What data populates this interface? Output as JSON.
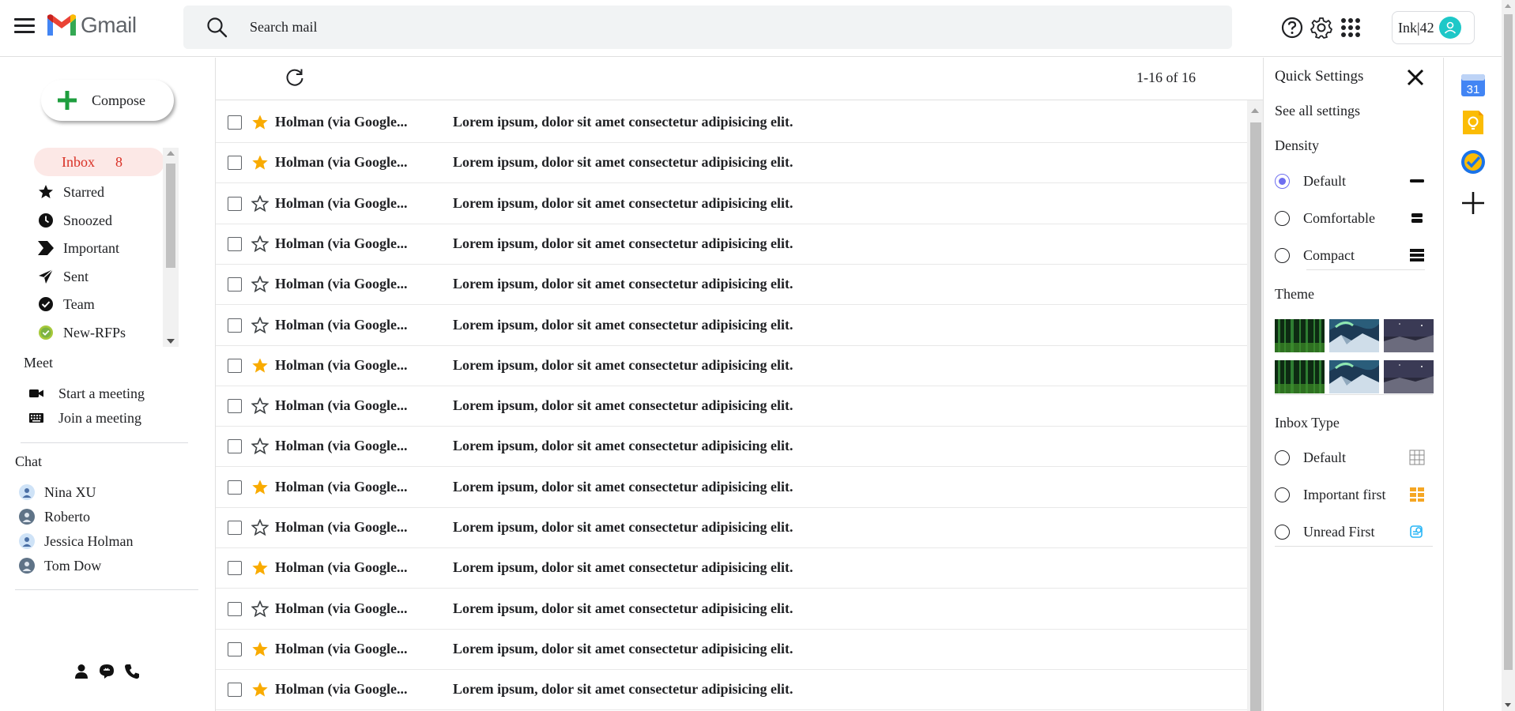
{
  "header": {
    "logo_text": "Gmail",
    "search_placeholder": "Search mail",
    "account_label": "Ink|42",
    "icons": [
      "menu-icon",
      "search-icon",
      "help-icon",
      "gear-icon",
      "apps-grid-icon",
      "account-avatar-icon"
    ]
  },
  "sidebar": {
    "compose_label": "Compose",
    "labels": [
      {
        "name": "Inbox",
        "count": "8",
        "icon": "inbox",
        "active": true
      },
      {
        "name": "Starred",
        "icon": "star-icon"
      },
      {
        "name": "Snoozed",
        "icon": "clock-icon"
      },
      {
        "name": "Important",
        "icon": "important-icon"
      },
      {
        "name": "Sent",
        "icon": "send-icon"
      },
      {
        "name": "Team",
        "icon": "check-circle-icon"
      },
      {
        "name": "New-RFPs",
        "icon": "green-check-icon"
      }
    ],
    "meet": {
      "title": "Meet",
      "items": [
        {
          "label": "Start a meeting",
          "icon": "video-icon"
        },
        {
          "label": "Join a meeting",
          "icon": "keyboard-icon"
        }
      ]
    },
    "chat": {
      "title": "Chat",
      "contacts": [
        {
          "name": "Nina XU",
          "avatar": "female"
        },
        {
          "name": "Roberto",
          "avatar": "generic"
        },
        {
          "name": "Jessica Holman",
          "avatar": "female"
        },
        {
          "name": "Tom Dow",
          "avatar": "generic"
        }
      ]
    },
    "bottom_icons": [
      "person-icon",
      "chat-bubble-icon",
      "phone-icon"
    ]
  },
  "mail": {
    "pager": "1-16 of 16",
    "rows": [
      {
        "sender": "Holman (via Google...",
        "subject": "Lorem ipsum, dolor sit amet consectetur adipisicing elit.",
        "starred": true
      },
      {
        "sender": "Holman (via Google...",
        "subject": "Lorem ipsum, dolor sit amet consectetur adipisicing elit.",
        "starred": true
      },
      {
        "sender": "Holman (via Google...",
        "subject": "Lorem ipsum, dolor sit amet consectetur adipisicing elit.",
        "starred": false
      },
      {
        "sender": "Holman (via Google...",
        "subject": "Lorem ipsum, dolor sit amet consectetur adipisicing elit.",
        "starred": false
      },
      {
        "sender": "Holman (via Google...",
        "subject": "Lorem ipsum, dolor sit amet consectetur adipisicing elit.",
        "starred": false
      },
      {
        "sender": "Holman (via Google...",
        "subject": "Lorem ipsum, dolor sit amet consectetur adipisicing elit.",
        "starred": false
      },
      {
        "sender": "Holman (via Google...",
        "subject": "Lorem ipsum, dolor sit amet consectetur adipisicing elit.",
        "starred": true
      },
      {
        "sender": "Holman (via Google...",
        "subject": "Lorem ipsum, dolor sit amet consectetur adipisicing elit.",
        "starred": false
      },
      {
        "sender": "Holman (via Google...",
        "subject": "Lorem ipsum, dolor sit amet consectetur adipisicing elit.",
        "starred": false
      },
      {
        "sender": "Holman (via Google...",
        "subject": "Lorem ipsum, dolor sit amet consectetur adipisicing elit.",
        "starred": true
      },
      {
        "sender": "Holman (via Google...",
        "subject": "Lorem ipsum, dolor sit amet consectetur adipisicing elit.",
        "starred": false
      },
      {
        "sender": "Holman (via Google...",
        "subject": "Lorem ipsum, dolor sit amet consectetur adipisicing elit.",
        "starred": true
      },
      {
        "sender": "Holman (via Google...",
        "subject": "Lorem ipsum, dolor sit amet consectetur adipisicing elit.",
        "starred": false
      },
      {
        "sender": "Holman (via Google...",
        "subject": "Lorem ipsum, dolor sit amet consectetur adipisicing elit.",
        "starred": true
      },
      {
        "sender": "Holman (via Google...",
        "subject": "Lorem ipsum, dolor sit amet consectetur adipisicing elit.",
        "starred": true
      }
    ]
  },
  "quick_settings": {
    "title": "Quick Settings",
    "see_all": "See all settings",
    "density": {
      "title": "Density",
      "options": [
        {
          "label": "Default",
          "selected": true,
          "icon": "density-default-icon"
        },
        {
          "label": "Comfortable",
          "selected": false,
          "icon": "density-comfortable-icon"
        },
        {
          "label": "Compact",
          "selected": false,
          "icon": "density-compact-icon"
        }
      ]
    },
    "theme": {
      "title": "Theme",
      "tiles": [
        "forest-theme",
        "aurora-theme",
        "night-theme",
        "forest-theme",
        "aurora-theme",
        "night-theme"
      ]
    },
    "inbox_type": {
      "title": "Inbox Type",
      "options": [
        {
          "label": "Default",
          "selected": false,
          "icon": "inbox-default-icon"
        },
        {
          "label": "Important first",
          "selected": false,
          "icon": "important-first-icon"
        },
        {
          "label": "Unread First",
          "selected": false,
          "icon": "unread-first-icon"
        }
      ]
    }
  },
  "side_apps": [
    "calendar-icon",
    "keep-icon",
    "tasks-icon",
    "add-icon"
  ],
  "calendar_day": "31",
  "colors": {
    "accent_red": "#d93025",
    "inbox_bg": "#fce8e6",
    "star_yellow": "#f9ab00",
    "radio_selected": "#6e6ef0",
    "avatar_teal": "#1ec8c8"
  }
}
